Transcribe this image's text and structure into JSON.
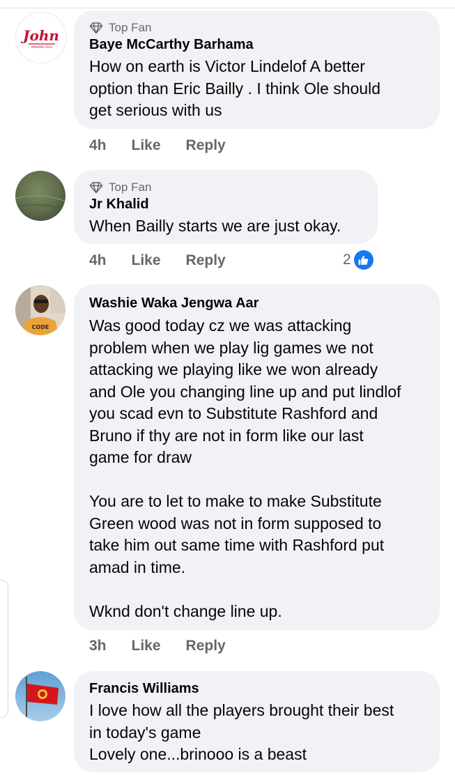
{
  "comments": [
    {
      "badge": "Top Fan",
      "author": "Baye McCarthy Barhama",
      "text": "How on earth is Victor Lindelof A better\noption than Eric Bailly . I think Ole should\nget serious with us",
      "time": "4h",
      "like_label": "Like",
      "reply_label": "Reply",
      "avatar_logo": "John",
      "avatar_caption": "MAHAMA 2020"
    },
    {
      "badge": "Top Fan",
      "author": "Jr Khalid",
      "text": "When Bailly starts we are just okay.",
      "time": "4h",
      "like_label": "Like",
      "reply_label": "Reply",
      "reaction_count": "2",
      "reaction_icon": "thumbs-up-icon"
    },
    {
      "author": "Washie Waka Jengwa Aar",
      "text": "Was good today cz we was attacking\nproblem when we play lig games we not\nattacking we playing like we won already\nand Ole you changing line up and put lindlof\nyou scad evn to Substitute Rashford  and\nBruno if thy are not in form like our last\ngame for draw\n\nYou are to let to make to make Substitute\nGreen wood was not in form supposed to\ntake him out same time with Rashford put\namad in time.\n\nWknd don't change line up.",
      "time": "3h",
      "like_label": "Like",
      "reply_label": "Reply",
      "avatar_shirt_text": "CODE"
    },
    {
      "author": "Francis Williams",
      "text": "I love  how all the players brought their best\nin today's game\nLovely one...brinooo is a beast"
    }
  ],
  "colors": {
    "bubble": "#f0f2f5",
    "meta_text": "#65676b",
    "like_blue": "#1877f2",
    "logo_red": "#c8102e"
  }
}
